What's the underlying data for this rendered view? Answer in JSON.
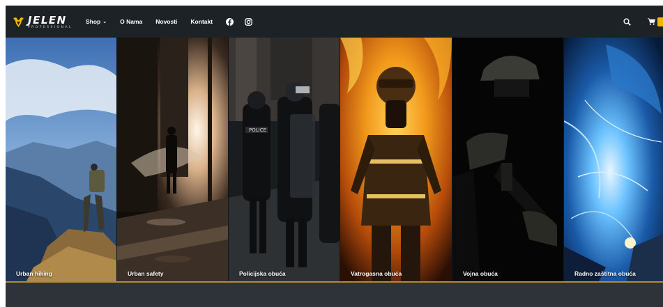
{
  "brand": {
    "name": "JELEN",
    "tagline": "PROFESSIONAL",
    "accent_color": "#f2b705"
  },
  "nav": {
    "items": [
      {
        "label": "Shop",
        "has_dropdown": true
      },
      {
        "label": "O Nama"
      },
      {
        "label": "Novosti"
      },
      {
        "label": "Kontakt"
      }
    ],
    "social": [
      "facebook-icon",
      "instagram-icon"
    ]
  },
  "header_actions": {
    "icons": [
      "search-icon",
      "cart-icon"
    ]
  },
  "categories": [
    {
      "label": "Urban hiking"
    },
    {
      "label": "Urban safety"
    },
    {
      "label": "Policijska obuća"
    },
    {
      "label": "Vatrogasna obuća"
    },
    {
      "label": "Vojna obuća"
    },
    {
      "label": "Radno zaštitna obuća"
    }
  ]
}
